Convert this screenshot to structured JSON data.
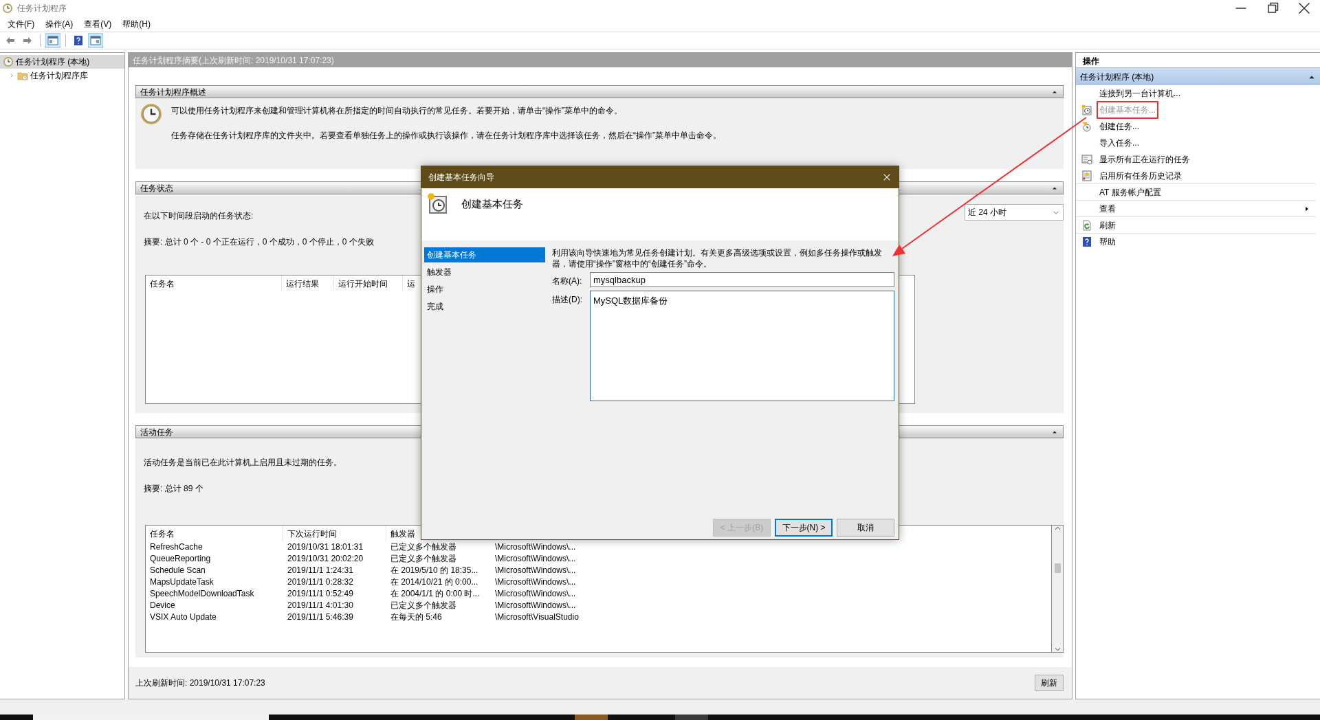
{
  "window": {
    "title": "任务计划程序"
  },
  "menu": [
    "文件(F)",
    "操作(A)",
    "查看(V)",
    "帮助(H)"
  ],
  "toolbar": [
    [
      {
        "kind": "back",
        "pressed": false
      },
      {
        "kind": "forward",
        "pressed": false
      }
    ],
    [
      {
        "kind": "console-tree",
        "pressed": true
      }
    ],
    [
      {
        "kind": "help",
        "pressed": false
      },
      {
        "kind": "action-pane",
        "pressed": true
      }
    ]
  ],
  "tree": [
    {
      "label": "任务计划程序 (本地)",
      "selected": true,
      "children": [
        {
          "label": "任务计划程序库",
          "selected": false,
          "expanded": false
        }
      ]
    }
  ],
  "summary": {
    "title": "任务计划程序摘要(上次刷新时间: 2019/10/31 17:07:23)",
    "sections": [
      {
        "kind": "overview",
        "title": "任务计划程序概述",
        "expanded": true,
        "paragraphs": [
          "可以使用任务计划程序来创建和管理计算机将在所指定的时间自动执行的常见任务。若要开始，请单击“操作”菜单中的命令。",
          "任务存储在任务计划程序库的文件夹中。若要查看单独任务上的操作或执行该操作，请在任务计划程序库中选择该任务，然后在“操作”菜单中单击命令。"
        ]
      },
      {
        "kind": "status",
        "title": "任务状态",
        "expanded": true,
        "label": "在以下时间段启动的任务状态:",
        "summary": "摘要: 总计 0 个 - 0 个正在运行，0 个成功，0 个停止，0 个失败",
        "range": "近 24 小时",
        "table": {
          "columns": [
            "任务名",
            "运行结果",
            "运行开始时间",
            "运"
          ]
        }
      },
      {
        "kind": "active",
        "title": "活动任务",
        "expanded": true,
        "label": "活动任务是当前已在此计算机上启用且未过期的任务。",
        "summary": "摘要: 总计 89 个",
        "table": {
          "columns": [
            "任务名",
            "下次运行时间",
            "触发器"
          ],
          "rows": [
            [
              "RefreshCache",
              "2019/10/31 18:01:31",
              "已定义多个触发器",
              "\\Microsoft\\Windows\\..."
            ],
            [
              "QueueReporting",
              "2019/10/31 20:02:20",
              "已定义多个触发器",
              "\\Microsoft\\Windows\\..."
            ],
            [
              "Schedule Scan",
              "2019/11/1 1:24:31",
              "在 2019/5/10 的 18:35...",
              "\\Microsoft\\Windows\\..."
            ],
            [
              "MapsUpdateTask",
              "2019/11/1 0:28:32",
              "在 2014/10/21 的 0:00...",
              "\\Microsoft\\Windows\\..."
            ],
            [
              "SpeechModelDownloadTask",
              "2019/11/1 0:52:49",
              "在 2004/1/1 的 0:00 时...",
              "\\Microsoft\\Windows\\..."
            ],
            [
              "Device",
              "2019/11/1 4:01:30",
              "已定义多个触发器",
              "\\Microsoft\\Windows\\..."
            ],
            [
              "VSIX Auto Update",
              "2019/11/1 5:46:39",
              "在每天的 5:46",
              "\\Microsoft\\VisualStudio"
            ]
          ]
        }
      }
    ],
    "footer": {
      "text": "上次刷新时间: 2019/10/31 17:07:23",
      "button": "刷新"
    }
  },
  "actions": {
    "title": "操作",
    "group": {
      "title": "任务计划程序 (本地)",
      "expanded": true
    },
    "items": [
      {
        "label": "连接到另一台计算机...",
        "disabled": false,
        "highlighted": false,
        "submenu": false
      },
      {
        "label": "创建基本任务...",
        "disabled": true,
        "highlighted": true,
        "submenu": false
      },
      {
        "label": "创建任务...",
        "disabled": false,
        "highlighted": false,
        "submenu": false
      },
      {
        "label": "导入任务...",
        "disabled": false,
        "highlighted": false,
        "submenu": false
      },
      {
        "label": "显示所有正在运行的任务",
        "disabled": false,
        "highlighted": false,
        "submenu": false
      },
      {
        "label": "启用所有任务历史记录",
        "disabled": false,
        "highlighted": false,
        "submenu": false
      },
      {
        "label": "AT 服务帐户配置",
        "disabled": false,
        "highlighted": false,
        "submenu": false
      },
      {
        "label": "查看",
        "disabled": false,
        "highlighted": false,
        "submenu": true
      },
      {
        "label": "刷新",
        "disabled": false,
        "highlighted": false,
        "submenu": false
      },
      {
        "label": "帮助",
        "disabled": false,
        "highlighted": false,
        "submenu": false
      }
    ]
  },
  "dialog": {
    "title": "创建基本任务向导",
    "heading": "创建基本任务",
    "steps": [
      {
        "label": "创建基本任务",
        "selected": true
      },
      {
        "label": "触发器",
        "selected": false
      },
      {
        "label": "操作",
        "selected": false
      },
      {
        "label": "完成",
        "selected": false
      }
    ],
    "intro": "利用该向导快速地为常见任务创建计划。有关更多高级选项或设置，例如多任务操作或触发器，请使用“操作”窗格中的“创建任务”命令。",
    "fields": [
      {
        "kind": "line",
        "label": "名称(A):",
        "value": "mysqlbackup"
      },
      {
        "kind": "multiline",
        "label": "描述(D):",
        "value": "MySQL数据库备份"
      }
    ],
    "buttons": [
      {
        "label": "< 上一步(B)",
        "disabled": true,
        "default": false
      },
      {
        "label": "下一步(N) >",
        "disabled": false,
        "default": true
      },
      {
        "label": "取消",
        "disabled": false,
        "default": false
      }
    ]
  }
}
